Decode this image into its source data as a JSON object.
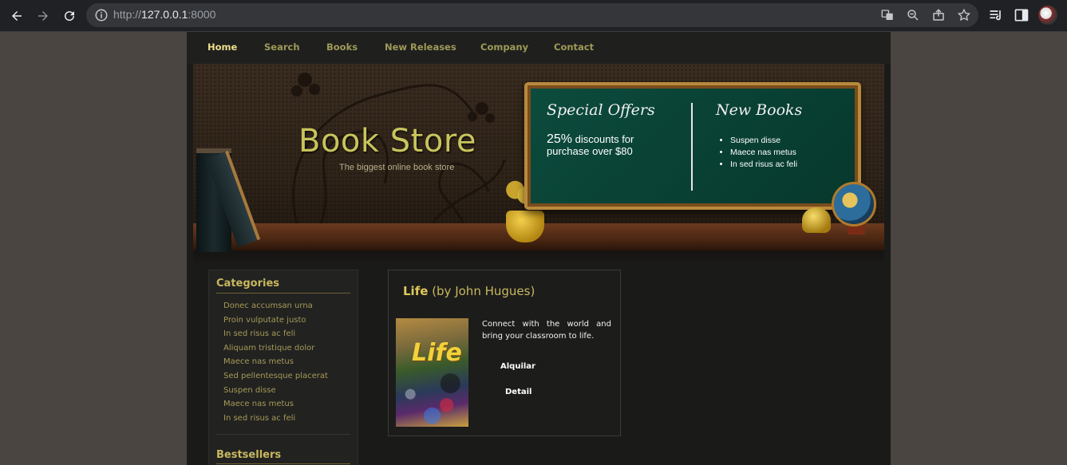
{
  "browser": {
    "url_prefix": "http://",
    "url_host": "127.0.0.1",
    "url_rest": ":8000"
  },
  "nav": {
    "items": [
      "Home",
      "Search",
      "Books",
      "New Releases",
      "Company",
      "Contact"
    ],
    "active": "Home"
  },
  "banner": {
    "title": "Book Store",
    "subtitle": "The biggest online book store",
    "special_offers_title": "Special Offers",
    "special_offers_pct": "25%",
    "special_offers_line1": "discounts for",
    "special_offers_line2": "purchase over $80",
    "new_books_title": "New Books",
    "new_books": [
      "Suspen disse",
      "Maece nas metus",
      "In sed risus ac feli"
    ]
  },
  "sidebar": {
    "categories_title": "Categories",
    "categories": [
      "Donec accumsan urna",
      "Proin vulputate justo",
      "In sed risus ac feli",
      "Aliquam tristique dolor",
      "Maece nas metus",
      "Sed pellentesque placerat",
      "Suspen disse",
      "Maece nas metus",
      "In sed risus ac feli"
    ],
    "bestsellers_title": "Bestsellers"
  },
  "product": {
    "title": "Life",
    "author": "(by John Hugues)",
    "cover_text": "Life",
    "description": "Connect with the world and bring your classroom to life.",
    "rent_label": "Alquilar",
    "detail_label": "Detail"
  },
  "colors": {
    "nav_text": "#9d9a58",
    "nav_active": "#ecdf8a",
    "heading": "#c8b85e",
    "chalkboard": "#0c4b3d"
  }
}
